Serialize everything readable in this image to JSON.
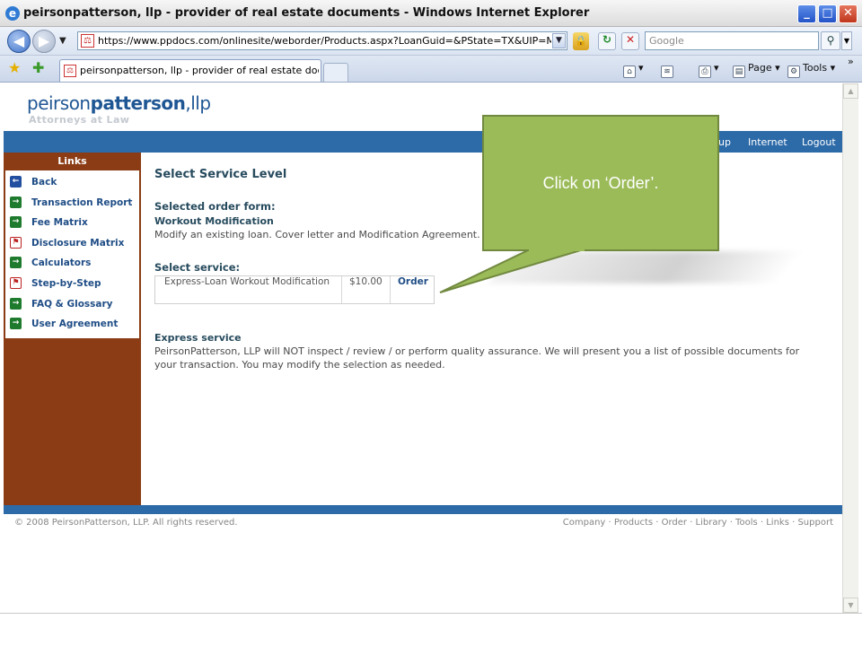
{
  "window": {
    "title": "peirsonpatterson, llp - provider of real estate documents - Windows Internet Explorer",
    "minimize": "_",
    "maximize": "□",
    "close": "✕"
  },
  "address_bar": {
    "url": "https://www.ppdocs.com/onlinesite/weborder/Products.aspx?LoanGuid=&PState=TX&UIP=MOD&ConduitId",
    "search_placeholder": "Google"
  },
  "tab": {
    "title": "peirsonpatterson, llp - provider of real estate docume..."
  },
  "command_bar": {
    "page_label": "Page",
    "tools_label": "Tools",
    "more": "»"
  },
  "site": {
    "logo_light": "peirson",
    "logo_bold": "patterson",
    "logo_suffix": ",llp",
    "logo_sub": "Attorneys at Law"
  },
  "topnav": {
    "items": [
      "up",
      "Internet",
      "Logout"
    ]
  },
  "sidebar": {
    "header": "Links",
    "items": [
      {
        "label": "Back",
        "icon": "back-arrow-icon"
      },
      {
        "label": "Transaction Report",
        "icon": "arrow-right-icon"
      },
      {
        "label": "Fee Matrix",
        "icon": "arrow-right-icon"
      },
      {
        "label": "Disclosure Matrix",
        "icon": "pdf-icon"
      },
      {
        "label": "Calculators",
        "icon": "arrow-right-icon"
      },
      {
        "label": "Step-by-Step",
        "icon": "pdf-icon"
      },
      {
        "label": "FAQ & Glossary",
        "icon": "arrow-right-icon"
      },
      {
        "label": "User Agreement",
        "icon": "arrow-right-icon"
      }
    ]
  },
  "main": {
    "title": "Select Service Level",
    "selected_order_form_label": "Selected order form:",
    "form_name": "Workout Modification",
    "form_description": "Modify an existing loan. Cover letter and Modification Agreement.",
    "select_service_label": "Select service:",
    "service": {
      "name": "Express-Loan Workout Modification",
      "price": "$10.00",
      "action": "Order"
    },
    "express_title": "Express service",
    "express_line1": "PeirsonPatterson, LLP will NOT inspect / review / or perform quality assurance. We will present you a list of possible documents for",
    "express_line2": "your transaction. You may modify the selection as needed."
  },
  "footer": {
    "copyright": "© 2008 PeirsonPatterson, LLP. All rights reserved.",
    "links": "Company · Products · Order · Library · Tools · Links · Support"
  },
  "callout": {
    "text": "Click on ‘Order’.",
    "fill": "#9bbb59",
    "border": "#71893f"
  },
  "colors": {
    "nav_blue": "#2c6aa8",
    "sidebar_brown": "#8b3c15",
    "link_blue": "#1f4d86",
    "heading": "#274b5e"
  }
}
